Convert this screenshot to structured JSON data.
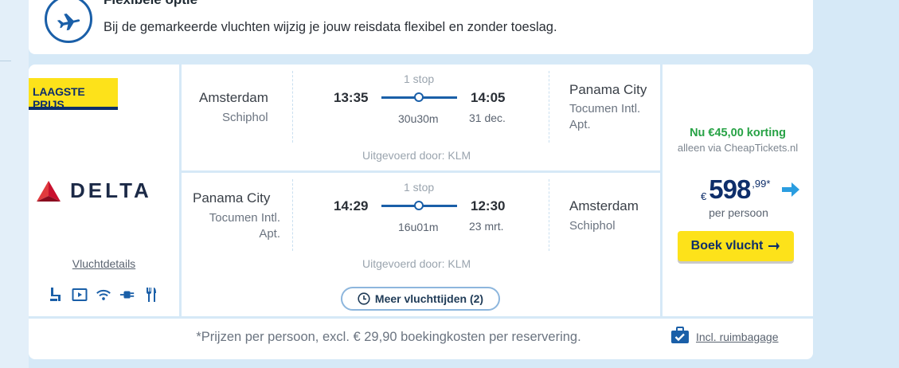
{
  "flex_option": {
    "title": "Flexibele optie",
    "text": "Bij de gemarkeerde vluchten wijzig je jouw reisdata flexibel en zonder toeslag.",
    "icon": "airplane-icon"
  },
  "airline": {
    "badge": "LAAGSTE PRIJS",
    "name": "DELTA",
    "details_link": "Vluchtdetails",
    "amenities": [
      "seat-icon",
      "entertainment-icon",
      "wifi-icon",
      "power-plug-icon",
      "meal-icon"
    ]
  },
  "outbound": {
    "from_city": "Amsterdam",
    "from_airport": "Schiphol",
    "depart_time": "13:35",
    "stops": "1 stop",
    "duration": "30u30m",
    "arrive_time": "14:05",
    "arrive_date": "31 dec.",
    "to_city": "Panama City",
    "to_airport": "Tocumen Intl. Apt.",
    "operator": "Uitgevoerd door: KLM"
  },
  "inbound": {
    "from_city": "Panama City",
    "from_airport": "Tocumen Intl. Apt.",
    "depart_time": "14:29",
    "stops": "1 stop",
    "duration": "16u01m",
    "arrive_time": "12:30",
    "arrive_date": "23 mrt.",
    "to_city": "Amsterdam",
    "to_airport": "Schiphol",
    "operator": "Uitgevoerd door: KLM"
  },
  "more_times": "Meer vluchttijden (2)",
  "price": {
    "discount": "Nu €45,00 korting",
    "discount_sub": "alleen via CheapTickets.nl",
    "currency": "€",
    "amount": "598",
    "cents": ",99*",
    "per_person": "per persoon",
    "book_label": "Boek vlucht"
  },
  "footer": {
    "note": "*Prijzen per persoon, excl. € 29,90 boekingkosten per reservering.",
    "baggage": "Incl. ruimbagage"
  },
  "colors": {
    "brand_blue": "#1a5fa8",
    "yellow": "#fde21a",
    "navy": "#0e2e6a",
    "green": "#27a245"
  }
}
